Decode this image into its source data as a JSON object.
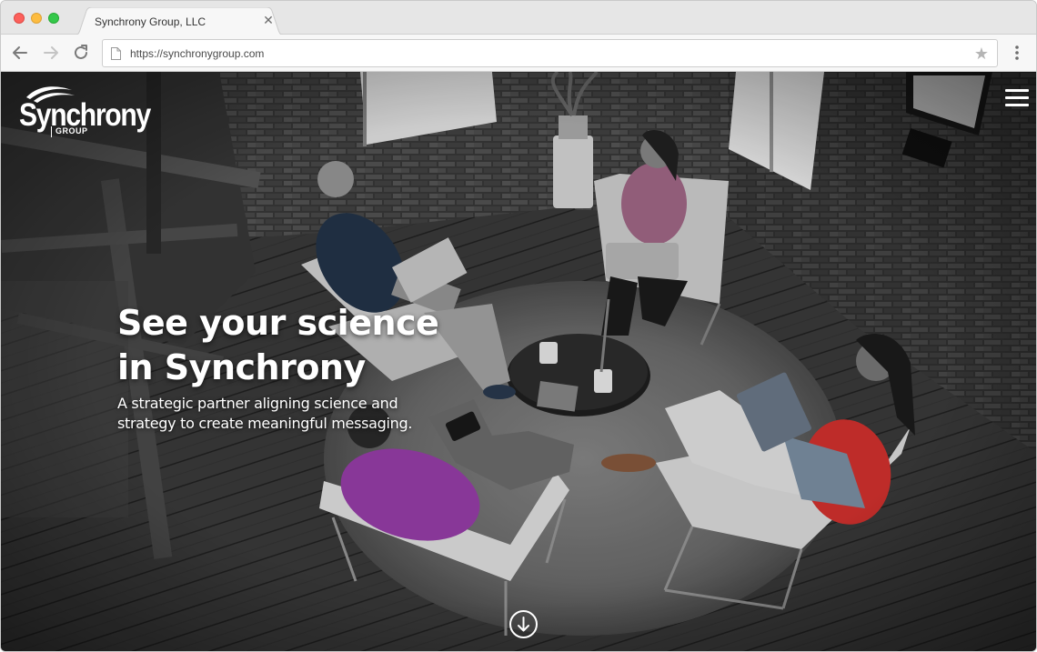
{
  "browser": {
    "tab_title": "Synchrony Group, LLC",
    "url": "https://synchronygroup.com"
  },
  "site": {
    "logo_word": "Synchrony",
    "logo_sub": "GROUP",
    "headline_line1": "See your science",
    "headline_line2": "in Synchrony",
    "subhead_line1": "A strategic partner aligning science and",
    "subhead_line2": "strategy to create meaningful messaging."
  },
  "colors": {
    "tab_bar": "#e6e6e6",
    "toolbar": "#f7f7f7",
    "purple_sweater": "#9b3fae",
    "red_sweater": "#d9332f",
    "pink_sweater": "#a56a8a",
    "navy_sweater": "#24354a"
  },
  "icons": [
    "close-icon",
    "back-arrow-icon",
    "forward-arrow-icon",
    "reload-icon",
    "page-icon",
    "star-icon",
    "menu-dots-icon",
    "hamburger-menu-icon",
    "arrow-down-icon"
  ]
}
